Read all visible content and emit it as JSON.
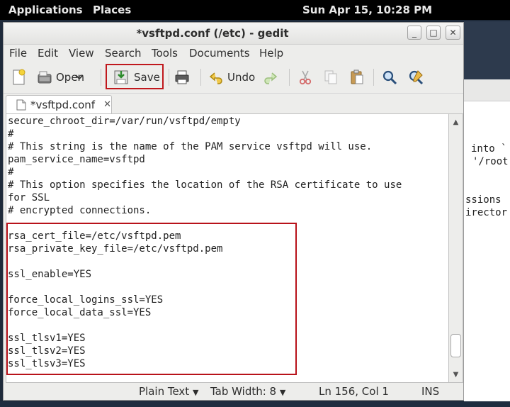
{
  "top_panel": {
    "applications": "Applications",
    "places": "Places",
    "clock": "Sun Apr 15, 10:28 PM"
  },
  "background_window": {
    "lines": [
      "into `",
      "'/root",
      "ssions",
      "irector"
    ]
  },
  "window": {
    "title": "*vsftpd.conf (/etc) - gedit",
    "buttons": {
      "minimize": "_",
      "maximize": "□",
      "close": "✕"
    }
  },
  "menu": {
    "file": "File",
    "edit": "Edit",
    "view": "View",
    "search": "Search",
    "tools": "Tools",
    "documents": "Documents",
    "help": "Help"
  },
  "toolbar": {
    "open_label": "Open",
    "save_label": "Save",
    "undo_label": "Undo",
    "icons": [
      "new-document-icon",
      "open-icon",
      "dropdown-arrow-icon",
      "save-icon",
      "print-icon",
      "undo-icon",
      "redo-icon",
      "cut-icon",
      "copy-icon",
      "paste-icon",
      "find-icon",
      "replace-icon"
    ]
  },
  "tab": {
    "label": "*vsftpd.conf",
    "close": "✕"
  },
  "editor": {
    "content": "secure_chroot_dir=/var/run/vsftpd/empty\n#\n# This string is the name of the PAM service vsftpd will use.\npam_service_name=vsftpd\n#\n# This option specifies the location of the RSA certificate to use\nfor SSL\n# encrypted connections.\n\nrsa_cert_file=/etc/vsftpd.pem\nrsa_private_key_file=/etc/vsftpd.pem\n\nssl_enable=YES\n\nforce_local_logins_ssl=YES\nforce_local_data_ssl=YES\n\nssl_tlsv1=YES\nssl_tlsv2=YES\nssl_tlsv3=YES\n"
  },
  "status": {
    "language": "Plain Text",
    "tab_width": "Tab Width:  8",
    "position": "Ln 156, Col 1",
    "mode": "INS"
  },
  "colors": {
    "highlight_red": "#c0181d",
    "panel_black": "#000000",
    "window_bg": "#ededeb"
  }
}
